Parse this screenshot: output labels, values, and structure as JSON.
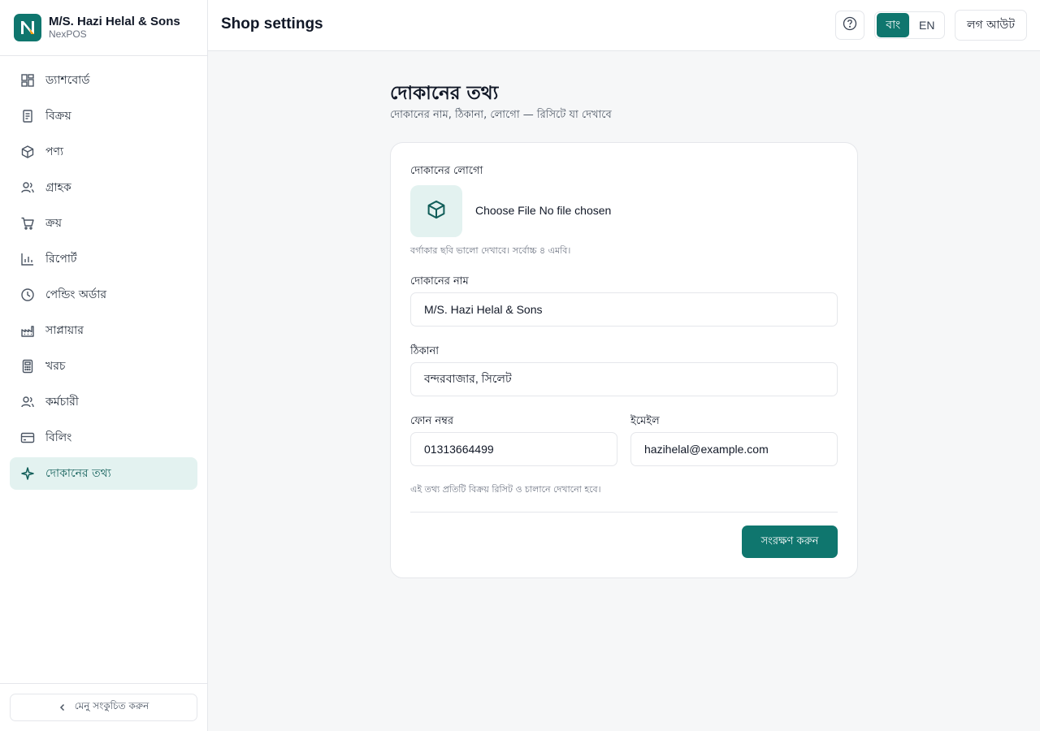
{
  "brand": {
    "name": "M/S. Hazi Helal & Sons",
    "sub": "NexPOS"
  },
  "sidebar": {
    "items": [
      {
        "label": "ড্যাশবোর্ড",
        "icon": "dashboard-icon"
      },
      {
        "label": "বিক্রয়",
        "icon": "receipt-icon"
      },
      {
        "label": "পণ্য",
        "icon": "box-icon"
      },
      {
        "label": "গ্রাহক",
        "icon": "users-icon"
      },
      {
        "label": "ক্রয়",
        "icon": "cart-icon"
      },
      {
        "label": "রিপোর্ট",
        "icon": "bar-chart-icon"
      },
      {
        "label": "পেন্ডিং অর্ডার",
        "icon": "clock-icon"
      },
      {
        "label": "সাপ্লায়ার",
        "icon": "factory-icon"
      },
      {
        "label": "খরচ",
        "icon": "calculator-icon"
      },
      {
        "label": "কর্মচারী",
        "icon": "users-icon"
      },
      {
        "label": "বিলিং",
        "icon": "credit-card-icon"
      },
      {
        "label": "দোকানের তথ্য",
        "icon": "sparkle-icon",
        "active": true
      }
    ],
    "collapse_label": "মেনু সংকুচিত করুন"
  },
  "header": {
    "title": "Shop settings",
    "lang_bn": "বাং",
    "lang_en": "EN",
    "logout_label": "লগ আউট"
  },
  "main": {
    "title": "দোকানের তথ্য",
    "subtitle": "দোকানের নাম, ঠিকানা, লোগো — রিসিটে যা দেখাবে",
    "logo_label": "দোকানের লোগো",
    "file_input_text": "Choose File No file chosen",
    "logo_hint": "বর্গাকার ছবি ভালো দেখাবে। সর্বোচ্চ ৪ এমবি।",
    "name_label": "দোকানের নাম",
    "name_value": "M/S. Hazi Helal & Sons",
    "address_label": "ঠিকানা",
    "address_value": "বন্দরবাজার, সিলেট",
    "phone_label": "ফোন নম্বর",
    "phone_value": "01313664499",
    "email_label": "ইমেইল",
    "email_value": "hazihelal@example.com",
    "info_hint": "এই তথ্য প্রতিটি বিক্রয় রিসিট ও চালানে দেখানো হবে।",
    "save_label": "সংরক্ষণ করুন"
  },
  "colors": {
    "accent": "#0f766e",
    "accent_light": "#e3f2f0"
  }
}
